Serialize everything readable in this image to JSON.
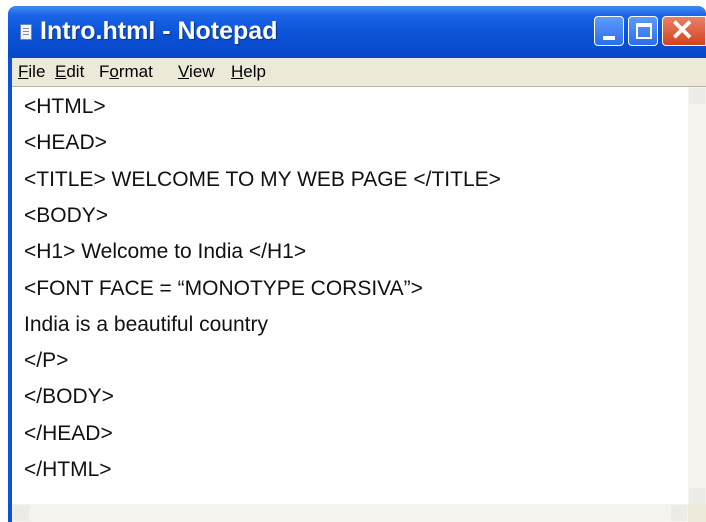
{
  "window": {
    "title": "Intro.html - Notepad"
  },
  "menu": [
    {
      "pre": "",
      "accel": "F",
      "post": "ile"
    },
    {
      "pre": "",
      "accel": "E",
      "post": "dit"
    },
    {
      "pre": "F",
      "accel": "o",
      "post": "rmat"
    },
    {
      "pre": "",
      "accel": "V",
      "post": "iew"
    },
    {
      "pre": "",
      "accel": "H",
      "post": "elp"
    }
  ],
  "editor": {
    "lines": [
      "<HTML>",
      "<HEAD>",
      "<TITLE> WELCOME TO MY WEB PAGE </TITLE>",
      "<BODY>",
      "<H1> Welcome to India </H1>",
      "<FONT FACE = “MONOTYPE CORSIVA”>",
      "India is a beautiful country",
      "</P>",
      "</BODY>",
      "</HEAD>",
      "</HTML>"
    ]
  },
  "colors": {
    "titlebar": "#0b52d6",
    "close_button": "#d4431c",
    "menubar": "#ece9d8"
  },
  "icons": {
    "app": "notepad-icon",
    "minimize": "minimize-icon",
    "maximize": "maximize-icon",
    "close": "close-icon"
  }
}
